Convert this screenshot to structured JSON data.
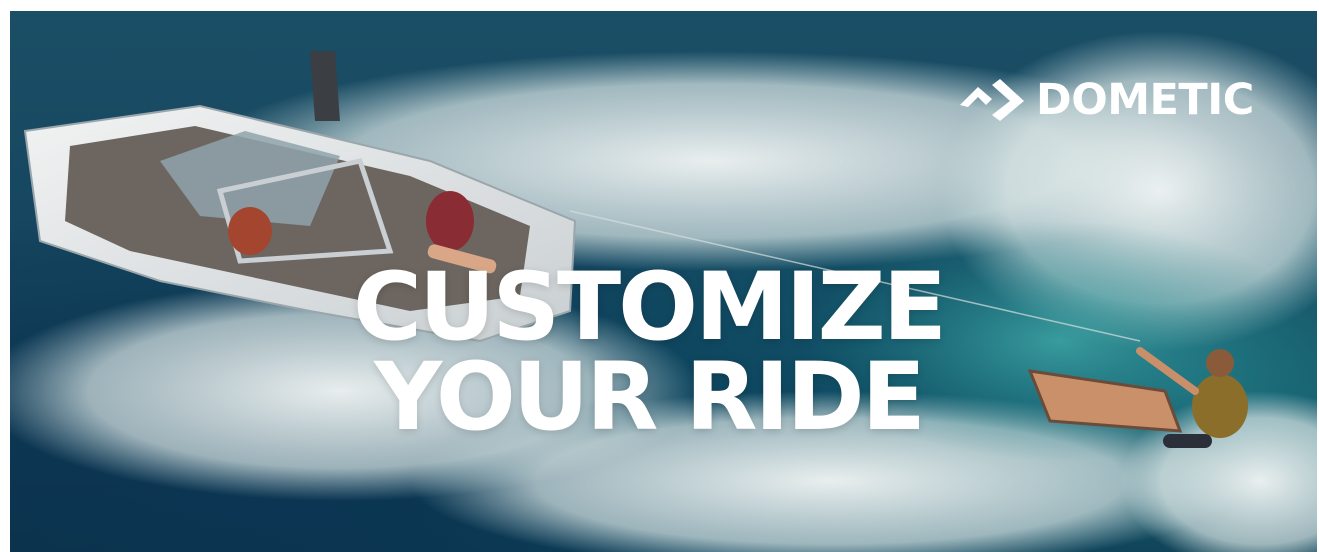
{
  "brand": {
    "name": "DOMETIC",
    "logo_icon": "dometic-chevron-logo-icon"
  },
  "headline": {
    "line1": "CUSTOMIZE",
    "line2": "YOUR RIDE"
  },
  "scene": {
    "water_color": "#164660",
    "foam_color": "#eef3f3",
    "boat_hull_color": "#e8eaea",
    "board_color": "#c9906a"
  }
}
